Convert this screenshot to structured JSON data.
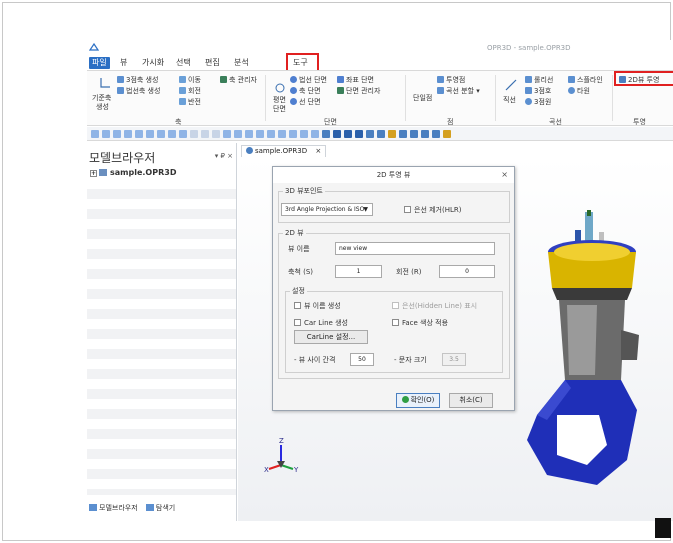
{
  "window": {
    "title": "OPR3D - sample.OPR3D"
  },
  "menu": {
    "items": [
      {
        "label": "파일",
        "active": true
      },
      {
        "label": "뷰"
      },
      {
        "label": "가시화"
      },
      {
        "label": "선택"
      },
      {
        "label": "편집"
      },
      {
        "label": "분석"
      },
      {
        "label": "도구"
      }
    ]
  },
  "ribbon": {
    "axis": {
      "base_axis_line1": "기준축",
      "base_axis_line2": "생성",
      "three_point_axis": "3점축 생성",
      "normal_axis": "법선축 생성",
      "move": "이동",
      "rotate": "회전",
      "invert": "반전",
      "axis_manager": "축 관리자",
      "group_label": "축"
    },
    "section": {
      "plane_line1": "평면",
      "plane_line2": "단면",
      "normal_section": "법선 단면",
      "axis_section": "축 단면",
      "line_section": "선 단면",
      "coord_section": "좌표 단면",
      "section_manager": "단면 관리자",
      "group_label": "단면"
    },
    "point": {
      "single_point": "단일점",
      "projected_point": "투영점",
      "curve_split": "곡선 분할 ▾",
      "group_label": "점"
    },
    "curve": {
      "straight": "직선",
      "fillet": "롤리선",
      "spline": "스플라인",
      "three_arc": "3점호",
      "ellipse": "타원",
      "three_circle": "3점원",
      "group_label": "곡선"
    },
    "projection": {
      "view_2d": "2D뷰 투영",
      "group_label": "투영"
    }
  },
  "panel": {
    "title": "모델브라우저",
    "controls": "▾ ₽ ×",
    "root": "sample.OPR3D",
    "tabs": [
      {
        "label": "모델브라우저"
      },
      {
        "label": "탐색기"
      }
    ]
  },
  "document_tab": {
    "label": "sample.OPR3D",
    "close": "×"
  },
  "dialog": {
    "title": "2D 투영 뷰",
    "close": "×",
    "viewpoint": {
      "legend": "3D 뷰포인트",
      "selected": "3rd Angle Projection & ISO",
      "hidden_line_label": "은선 제거(HLR)"
    },
    "view2d": {
      "legend": "2D 뷰",
      "name_label": "뷰 이름",
      "name_value": "new view",
      "scale_label": "축척 (S)",
      "scale_value": "1",
      "rotate_label": "회전 (R)",
      "rotate_value": "0",
      "settings": {
        "legend": "설정",
        "create_view_name": "뷰 이름 생성",
        "hidden_line_display": "은선(Hidden Line) 표시",
        "carline_create": "Car Line 생성",
        "face_color": "Face 색상 적용",
        "carline_settings": "CarLine 설정...",
        "view_gap_label": "- 뷰 사이 간격",
        "view_gap_value": "50",
        "char_size_label": "- 문자 크기",
        "char_size_value": "3.5"
      }
    },
    "ok": "확인(O)",
    "cancel": "취소(C)"
  },
  "colors": {
    "menu_active": "#2b6fc4",
    "highlight": "#e02020",
    "model_blue": "#1f2fb8",
    "model_yellow": "#e0b400"
  }
}
